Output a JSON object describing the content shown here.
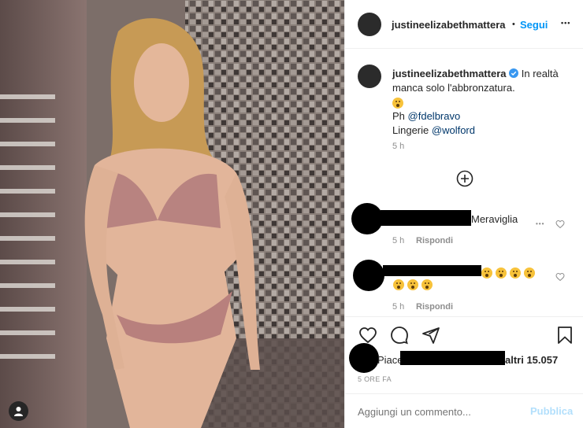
{
  "post": {
    "username": "justineelizabethmattera",
    "separator": "•",
    "follow_label": "Segui",
    "more_label": "•••"
  },
  "caption": {
    "username": "justineelizabethmattera",
    "text_line1": "In realtà",
    "text_line2": "manca solo l'abbronzatura.",
    "photo_prefix": "Ph",
    "photo_mention": "@fdelbravo",
    "lingerie_prefix": "Lingerie",
    "lingerie_mention": "@wolford",
    "time": "5 h"
  },
  "comments": [
    {
      "text": "Meraviglia",
      "time": "5 h",
      "reply_label": "Rispondi",
      "more": "•••"
    },
    {
      "time": "5 h",
      "reply_label": "Rispondi"
    }
  ],
  "likes": {
    "prefix": "Piace",
    "suffix": "altri 15.057"
  },
  "post_time": "5 ORE FA",
  "add_comment": {
    "placeholder": "Aggiungi un commento...",
    "publish_label": "Pubblica"
  },
  "icons": [
    "verified-badge-icon",
    "add-circle-icon",
    "heart-icon",
    "comment-icon",
    "share-icon",
    "bookmark-icon",
    "user-icon",
    "more-icon"
  ],
  "colors": {
    "accent": "#0095f6",
    "publish_disabled": "#b2dffc",
    "mention": "#00376b",
    "muted": "#8e8e8e"
  }
}
